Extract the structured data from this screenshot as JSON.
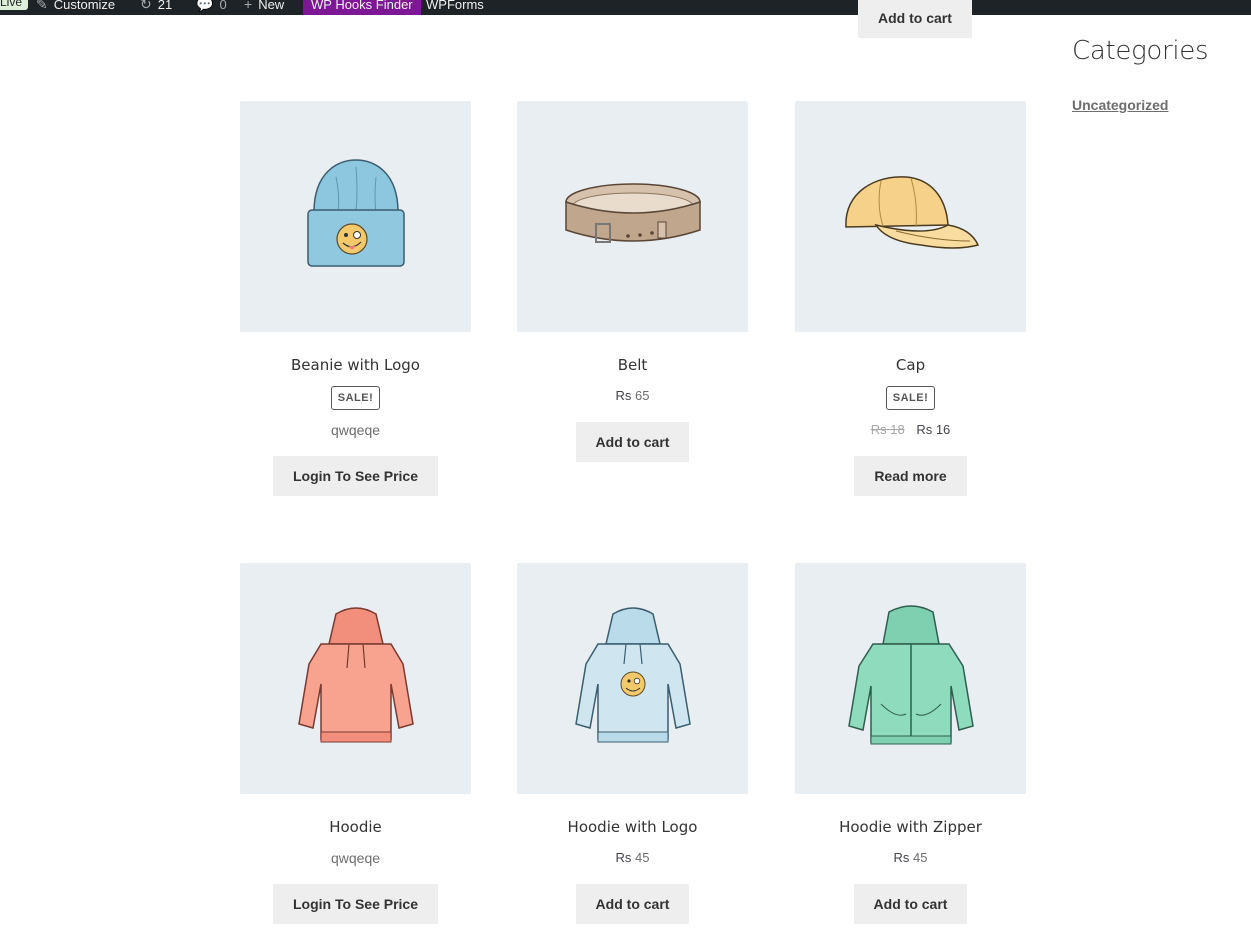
{
  "admin_bar": {
    "live_badge": "Live",
    "customize": "Customize",
    "updates_count": "21",
    "comments_count": "0",
    "new": "New",
    "hooks_finder": "WP Hooks Finder",
    "wpforms": "WPForms"
  },
  "top_row": {
    "add_to_cart": "Add to cart"
  },
  "sidebar": {
    "heading": "Categories",
    "categories": [
      "Uncategorized"
    ]
  },
  "products": [
    {
      "name": "Beanie with Logo",
      "sale": "SALE!",
      "price_text": "qwqeqe",
      "button": "Login To See Price",
      "icon": "beanie-image"
    },
    {
      "name": "Belt",
      "currency": "Rs",
      "price": "65",
      "button": "Add to cart",
      "icon": "belt-image"
    },
    {
      "name": "Cap",
      "sale": "SALE!",
      "currency": "Rs",
      "old_price": "18",
      "price": "16",
      "button": "Read more",
      "icon": "cap-image"
    },
    {
      "name": "Hoodie",
      "price_text": "qwqeqe",
      "button": "Login To See Price",
      "icon": "hoodie-image"
    },
    {
      "name": "Hoodie with Logo",
      "currency": "Rs",
      "price": "45",
      "button": "Add to cart",
      "icon": "hoodie-logo-image"
    },
    {
      "name": "Hoodie with Zipper",
      "currency": "Rs",
      "price": "45",
      "button": "Add to cart",
      "icon": "hoodie-zipper-image"
    }
  ],
  "colors": {
    "admin_bar_bg": "#1d2327",
    "hooks_finder_bg": "#7e1796",
    "thumb_bg": "#e9eef2",
    "button_bg": "#eeeeee"
  }
}
